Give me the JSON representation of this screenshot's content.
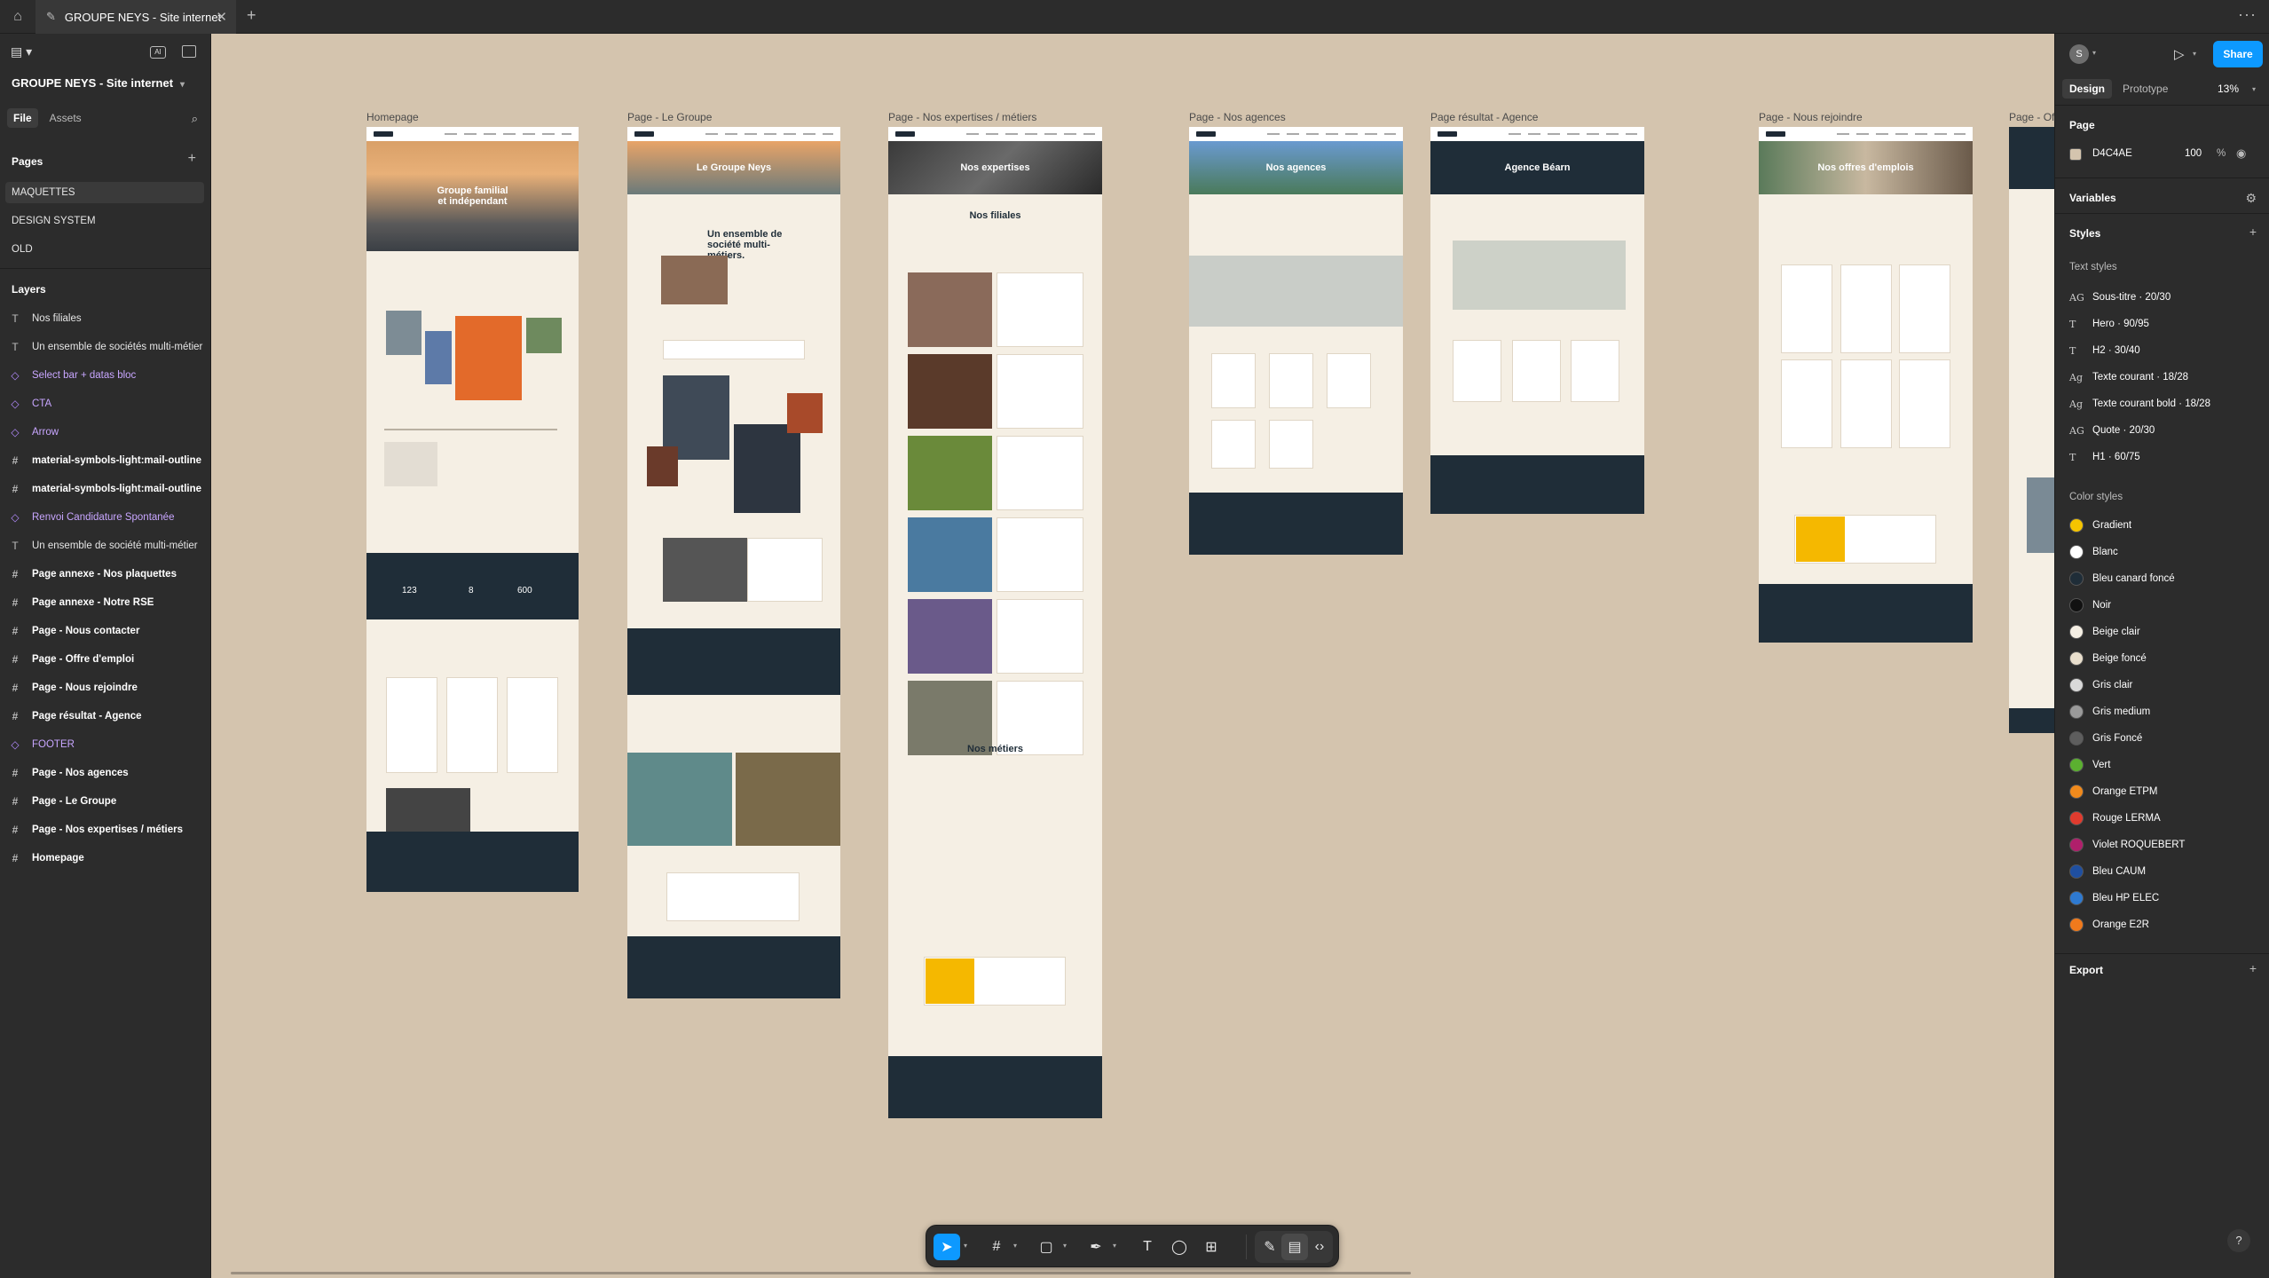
{
  "tab": {
    "title": "GROUPE NEYS - Site internet"
  },
  "left_panel": {
    "file_name": "GROUPE NEYS - Site internet",
    "tabs": {
      "file": "File",
      "assets": "Assets"
    },
    "ai_badge": "AI",
    "pages_header": "Pages",
    "pages": [
      "MAQUETTES",
      "DESIGN SYSTEM",
      "OLD"
    ],
    "layers_header": "Layers",
    "layers": [
      {
        "label": "Nos filiales",
        "kind": "text"
      },
      {
        "label": "Un ensemble de sociétés multi-métier",
        "kind": "text"
      },
      {
        "label": "Select bar + datas bloc",
        "kind": "component"
      },
      {
        "label": "CTA",
        "kind": "component"
      },
      {
        "label": "Arrow",
        "kind": "component"
      },
      {
        "label": "material-symbols-light:mail-outline",
        "kind": "frame"
      },
      {
        "label": "material-symbols-light:mail-outline",
        "kind": "frame"
      },
      {
        "label": "Renvoi Candidature Spontanée",
        "kind": "component"
      },
      {
        "label": "Un ensemble  de société multi-métier",
        "kind": "text"
      },
      {
        "label": "Page annexe - Nos plaquettes",
        "kind": "frame"
      },
      {
        "label": "Page annexe - Notre RSE",
        "kind": "frame"
      },
      {
        "label": "Page - Nous contacter",
        "kind": "frame"
      },
      {
        "label": "Page - Offre d'emploi",
        "kind": "frame"
      },
      {
        "label": "Page - Nous rejoindre",
        "kind": "frame"
      },
      {
        "label": "Page résultat - Agence",
        "kind": "frame"
      },
      {
        "label": "FOOTER",
        "kind": "component"
      },
      {
        "label": "Page - Nos agences",
        "kind": "frame"
      },
      {
        "label": "Page - Le Groupe",
        "kind": "frame"
      },
      {
        "label": "Page - Nos expertises / métiers",
        "kind": "frame"
      },
      {
        "label": "Homepage",
        "kind": "frame"
      }
    ]
  },
  "canvas": {
    "background": "#D4C4AE",
    "artboards": [
      {
        "label": "Homepage",
        "hero": "Groupe familial et indépendant"
      },
      {
        "label": "Page - Le Groupe",
        "hero": "Le Groupe Neys",
        "heading": "Un ensemble de société multi-métiers."
      },
      {
        "label": "Page - Nos expertises / métiers",
        "hero": "Nos expertises",
        "heading": "Nos filiales",
        "heading2": "Nos métiers"
      },
      {
        "label": "Page - Nos agences",
        "hero": "Nos agences"
      },
      {
        "label": "Page résultat - Agence",
        "hero": "Agence Béarn"
      },
      {
        "label": "Page - Nous rejoindre",
        "hero": "Nos offres d'emplois"
      },
      {
        "label": "Page - Of"
      }
    ],
    "stats": [
      "123",
      "8",
      "600"
    ]
  },
  "right_panel": {
    "avatar_initial": "S",
    "share": "Share",
    "tabs": {
      "design": "Design",
      "prototype": "Prototype"
    },
    "zoom": "13%",
    "page_header": "Page",
    "page_fill_hex": "D4C4AE",
    "page_fill_opacity": "100",
    "page_fill_color": "#D4C4AE",
    "variables_header": "Variables",
    "styles_header": "Styles",
    "text_styles_header": "Text styles",
    "text_styles": [
      {
        "icon": "AG",
        "label": "Sous-titre · 20/30"
      },
      {
        "icon": "T",
        "label": "Hero · 90/95"
      },
      {
        "icon": "T",
        "label": "H2 · 30/40"
      },
      {
        "icon": "Ag",
        "label": "Texte courant · 18/28"
      },
      {
        "icon": "Ag",
        "label": "Texte courant bold · 18/28"
      },
      {
        "icon": "AG",
        "label": "Quote · 20/30"
      },
      {
        "icon": "T",
        "label": "H1 · 60/75"
      }
    ],
    "color_styles_header": "Color styles",
    "color_styles": [
      {
        "label": "Gradient",
        "color": "#F5C400"
      },
      {
        "label": "Blanc",
        "color": "#FFFFFF"
      },
      {
        "label": "Bleu canard foncé",
        "color": "#1F2D38"
      },
      {
        "label": "Noir",
        "color": "#111111"
      },
      {
        "label": "Beige clair",
        "color": "#F5EFE4"
      },
      {
        "label": "Beige foncé",
        "color": "#E9DFCD"
      },
      {
        "label": "Gris clair",
        "color": "#D9D9D9"
      },
      {
        "label": "Gris medium",
        "color": "#9A9A9A"
      },
      {
        "label": "Gris Foncé",
        "color": "#5E5E5E"
      },
      {
        "label": "Vert",
        "color": "#5BB030"
      },
      {
        "label": "Orange ETPM",
        "color": "#F08A1C"
      },
      {
        "label": "Rouge LERMA",
        "color": "#E03B2E"
      },
      {
        "label": "Violet ROQUEBERT",
        "color": "#B01F6B"
      },
      {
        "label": "Bleu CAUM",
        "color": "#1F4FA0"
      },
      {
        "label": "Bleu HP ELEC",
        "color": "#2E7AD1"
      },
      {
        "label": "Orange E2R",
        "color": "#F07A1C"
      }
    ],
    "export_header": "Export",
    "help": "?"
  }
}
